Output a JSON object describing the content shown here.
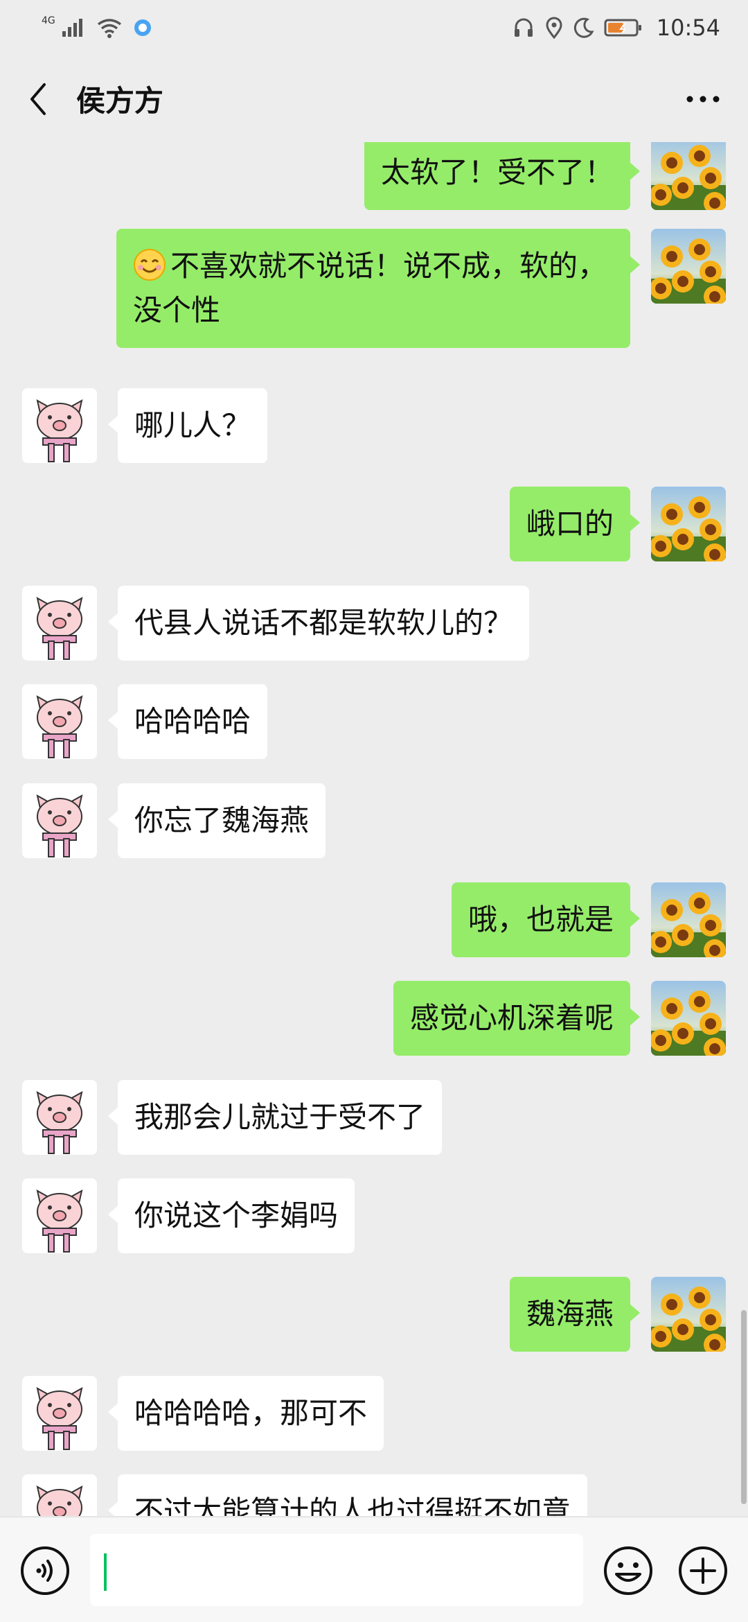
{
  "status_bar": {
    "network": "4G",
    "time": "10:54",
    "icons": [
      "signal-icon",
      "wifi-icon",
      "app-notification-icon",
      "headphones-icon",
      "location-icon",
      "moon-icon",
      "battery-icon"
    ]
  },
  "header": {
    "title": "侯方方",
    "back_icon": "chevron-left-icon",
    "more_icon": "more-dots-icon"
  },
  "messages": [
    {
      "side": "out",
      "text": "太软了！受不了！"
    },
    {
      "side": "out",
      "text": "不喜欢就不说话！说不成，软的，没个性",
      "emoji": "smile-emoji"
    },
    {
      "side": "in",
      "text": "哪儿人？"
    },
    {
      "side": "out",
      "text": "峨口的"
    },
    {
      "side": "in",
      "text": "代县人说话不都是软软儿的？"
    },
    {
      "side": "in",
      "text": "哈哈哈哈"
    },
    {
      "side": "in",
      "text": "你忘了魏海燕"
    },
    {
      "side": "out",
      "text": "哦，也就是"
    },
    {
      "side": "out",
      "text": "感觉心机深着呢"
    },
    {
      "side": "in",
      "text": "我那会儿就过于受不了"
    },
    {
      "side": "in",
      "text": "你说这个李娟吗"
    },
    {
      "side": "out",
      "text": "魏海燕"
    },
    {
      "side": "in",
      "text": "哈哈哈哈，那可不"
    },
    {
      "side": "in",
      "text": "不过太能算计的人也过得挺不如意"
    }
  ],
  "input_bar": {
    "voice_icon": "voice-icon",
    "emoji_icon": "emoji-icon",
    "plus_icon": "plus-icon",
    "text_value": ""
  },
  "colors": {
    "background": "#ededed",
    "outgoing_bubble": "#95ec69",
    "incoming_bubble": "#ffffff",
    "caret": "#07c160"
  }
}
